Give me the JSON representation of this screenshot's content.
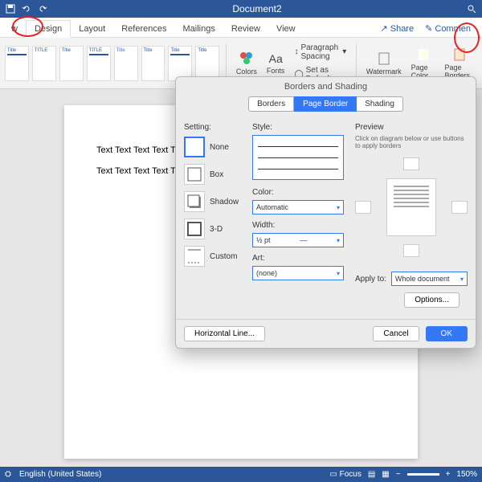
{
  "app": {
    "title": "Document2"
  },
  "tabs": {
    "items": [
      "w",
      "Design",
      "Layout",
      "References",
      "Mailings",
      "Review",
      "View"
    ],
    "active": 1,
    "share": "Share",
    "comments": "Commen"
  },
  "ribbon": {
    "themes": [
      {
        "title": "Title"
      },
      {
        "title": "TITLE"
      },
      {
        "title": "Title"
      },
      {
        "title": "TITLE"
      },
      {
        "title": "Title"
      },
      {
        "title": "Title"
      },
      {
        "title": "Title"
      },
      {
        "title": "Title"
      }
    ],
    "colors": "Colors",
    "fonts": "Fonts",
    "paragraph": "Paragraph Spacing",
    "default": "Set as Default",
    "watermark": "Watermark",
    "pagecolor": "Page Color",
    "pageborders": "Page Borders"
  },
  "doc": {
    "p1": "Text Text Text Text Text Text Te",
    "p2": "Text Text Text Text Text Text Te"
  },
  "dialog": {
    "title": "Borders and Shading",
    "tabs": [
      "Borders",
      "Page Border",
      "Shading"
    ],
    "setting_label": "Setting:",
    "settings": [
      "None",
      "Box",
      "Shadow",
      "3-D",
      "Custom"
    ],
    "style_label": "Style:",
    "color_label": "Color:",
    "color_val": "Automatic",
    "width_label": "Width:",
    "width_val": "½ pt",
    "art_label": "Art:",
    "art_val": "(none)",
    "preview_label": "Preview",
    "preview_hint": "Click on diagram below or use buttons to apply borders",
    "apply_label": "Apply to:",
    "apply_val": "Whole document",
    "options": "Options...",
    "hline": "Horizontal Line...",
    "cancel": "Cancel",
    "ok": "OK"
  },
  "status": {
    "lang": "English (United States)",
    "focus": "Focus",
    "zoom": "150%"
  }
}
